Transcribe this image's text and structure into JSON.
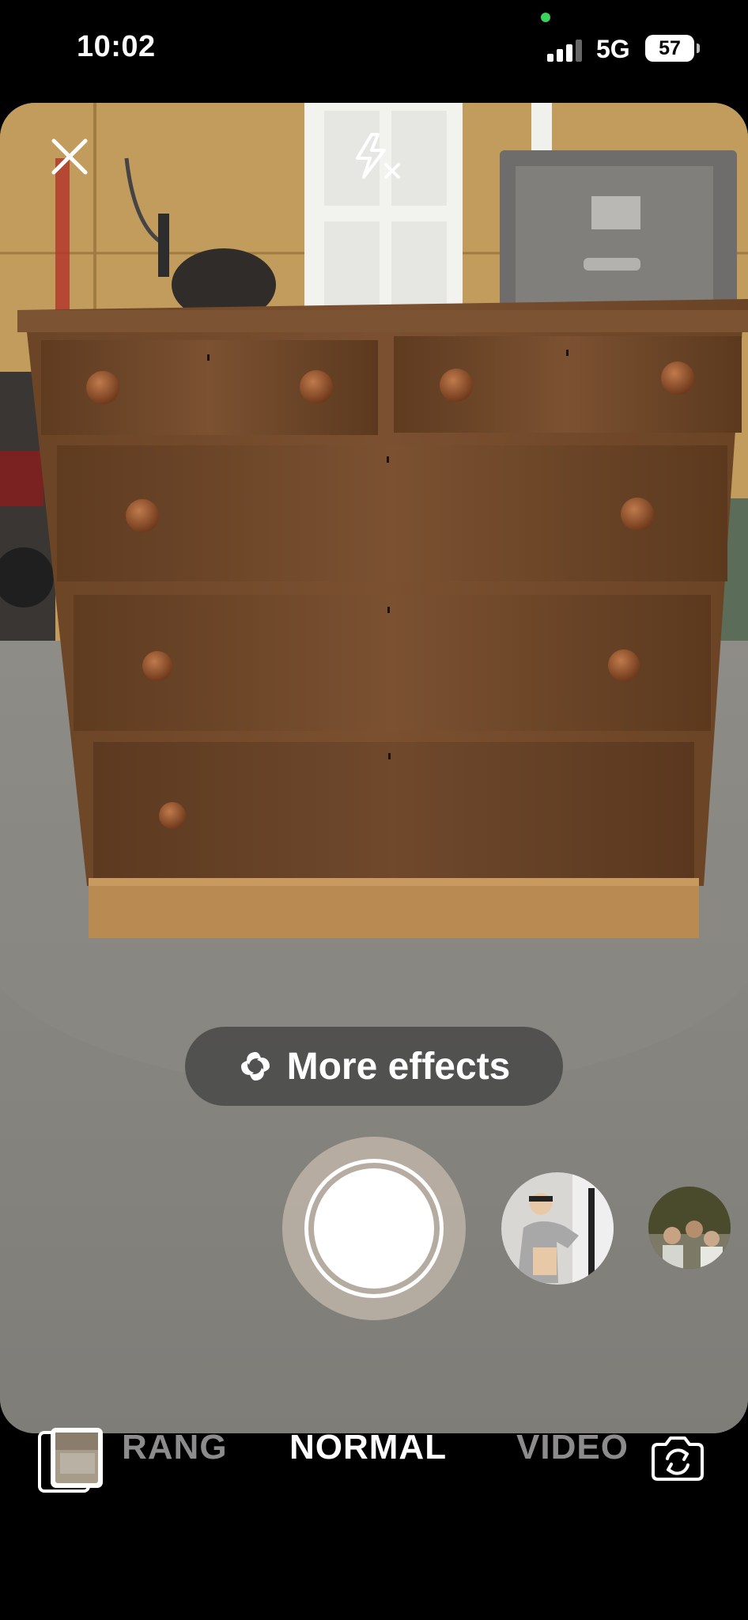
{
  "status_bar": {
    "time": "10:02",
    "network": "5G",
    "battery": "57",
    "signal_bars": 3
  },
  "camera": {
    "effects_label": "More effects",
    "modes": {
      "previous": "RANG",
      "current": "NORMAL",
      "next": "VIDEO"
    }
  },
  "icons": {
    "close": "close-icon",
    "flash": "flash-off-icon",
    "effects": "effects-icon",
    "gallery": "gallery-icon",
    "flip": "flip-camera-icon"
  },
  "colors": {
    "recording_indicator": "#3ad45b",
    "shutter": "#ffffff",
    "mode_inactive": "#8c8c8c"
  }
}
